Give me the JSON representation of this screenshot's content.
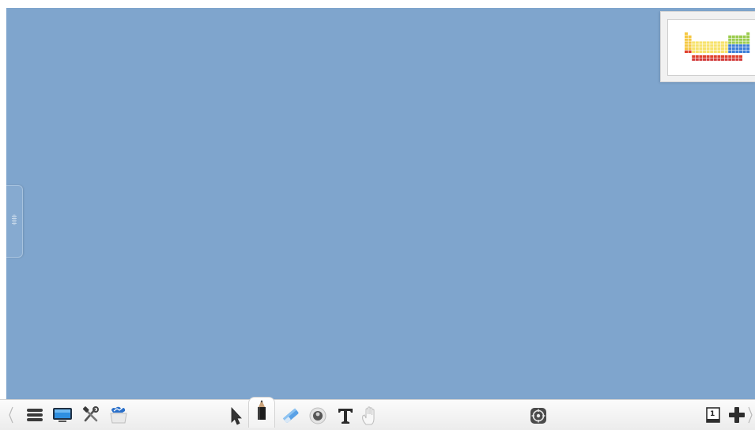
{
  "app": {
    "canvas_color": "#7fa5cd",
    "toolbar_color": "#f3f3f3"
  },
  "left_toolbar": [
    {
      "name": "menu",
      "icon": "menu-icon"
    },
    {
      "name": "display",
      "icon": "monitor-icon"
    },
    {
      "name": "tools",
      "icon": "tools-icon"
    },
    {
      "name": "resources",
      "icon": "folder-cloud-icon"
    }
  ],
  "center_toolbar": [
    {
      "name": "select",
      "icon": "cursor-arrow-icon"
    },
    {
      "name": "pen",
      "icon": "pencil-icon",
      "active": true
    },
    {
      "name": "eraser",
      "icon": "eraser-icon"
    },
    {
      "name": "spotlight",
      "icon": "spotlight-icon"
    },
    {
      "name": "text",
      "icon": "text-tool-icon",
      "glyph": "T"
    },
    {
      "name": "hand",
      "icon": "hand-icon"
    }
  ],
  "right_toolbar": {
    "page_number": "1",
    "add_page_icon": "plus-icon"
  },
  "thumbnail": {
    "icon": "periodic-table-thumbnail",
    "palette": [
      "#f7e26b",
      "#f5c842",
      "#9ccc4f",
      "#3d7ed8",
      "#e0402b",
      "#d23c3c"
    ]
  }
}
